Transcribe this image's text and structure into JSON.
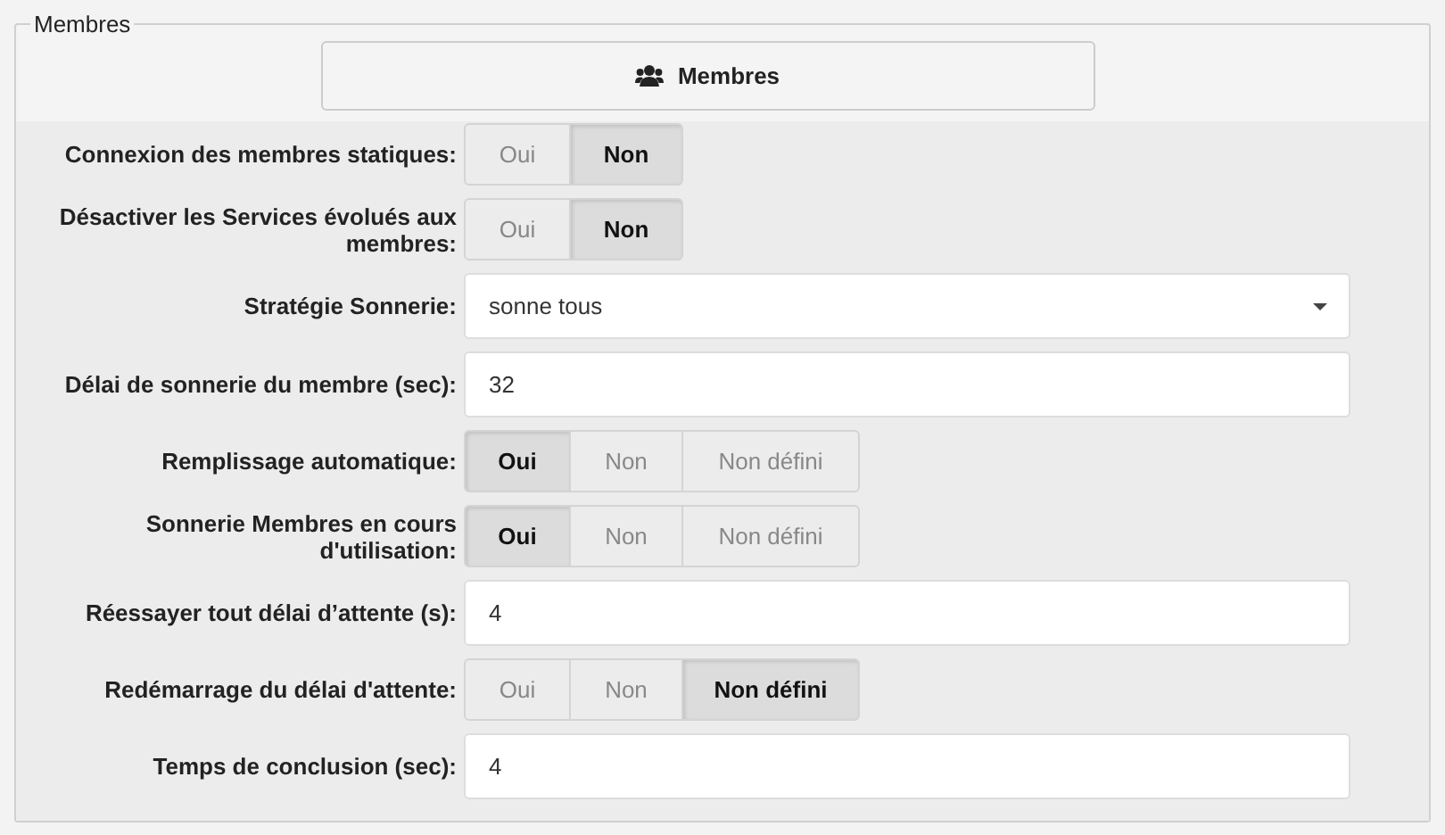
{
  "section": {
    "legend": "Membres",
    "header_button": "Membres"
  },
  "fields": [
    {
      "kind": "toggle",
      "label": "Connexion des membres statiques:",
      "options": [
        {
          "label": "Oui",
          "selected": false
        },
        {
          "label": "Non",
          "selected": true
        }
      ]
    },
    {
      "kind": "toggle",
      "label": "Désactiver les Services évolués aux membres:",
      "options": [
        {
          "label": "Oui",
          "selected": false
        },
        {
          "label": "Non",
          "selected": true
        }
      ]
    },
    {
      "kind": "select",
      "label": "Stratégie Sonnerie:",
      "value": "sonne tous"
    },
    {
      "kind": "input",
      "label": "Délai de sonnerie du membre (sec):",
      "value": "32"
    },
    {
      "kind": "toggle",
      "label": "Remplissage automatique:",
      "options": [
        {
          "label": "Oui",
          "selected": true
        },
        {
          "label": "Non",
          "selected": false
        },
        {
          "label": "Non défini",
          "selected": false
        }
      ]
    },
    {
      "kind": "toggle",
      "label": "Sonnerie Membres en cours d'utilisation:",
      "options": [
        {
          "label": "Oui",
          "selected": true
        },
        {
          "label": "Non",
          "selected": false
        },
        {
          "label": "Non défini",
          "selected": false
        }
      ]
    },
    {
      "kind": "input",
      "label": "Réessayer tout délai d’attente (s):",
      "value": "4"
    },
    {
      "kind": "toggle",
      "label": "Redémarrage du délai d'attente:",
      "options": [
        {
          "label": "Oui",
          "selected": false
        },
        {
          "label": "Non",
          "selected": false
        },
        {
          "label": "Non défini",
          "selected": true
        }
      ]
    },
    {
      "kind": "input",
      "label": "Temps de conclusion (sec):",
      "value": "4"
    }
  ]
}
